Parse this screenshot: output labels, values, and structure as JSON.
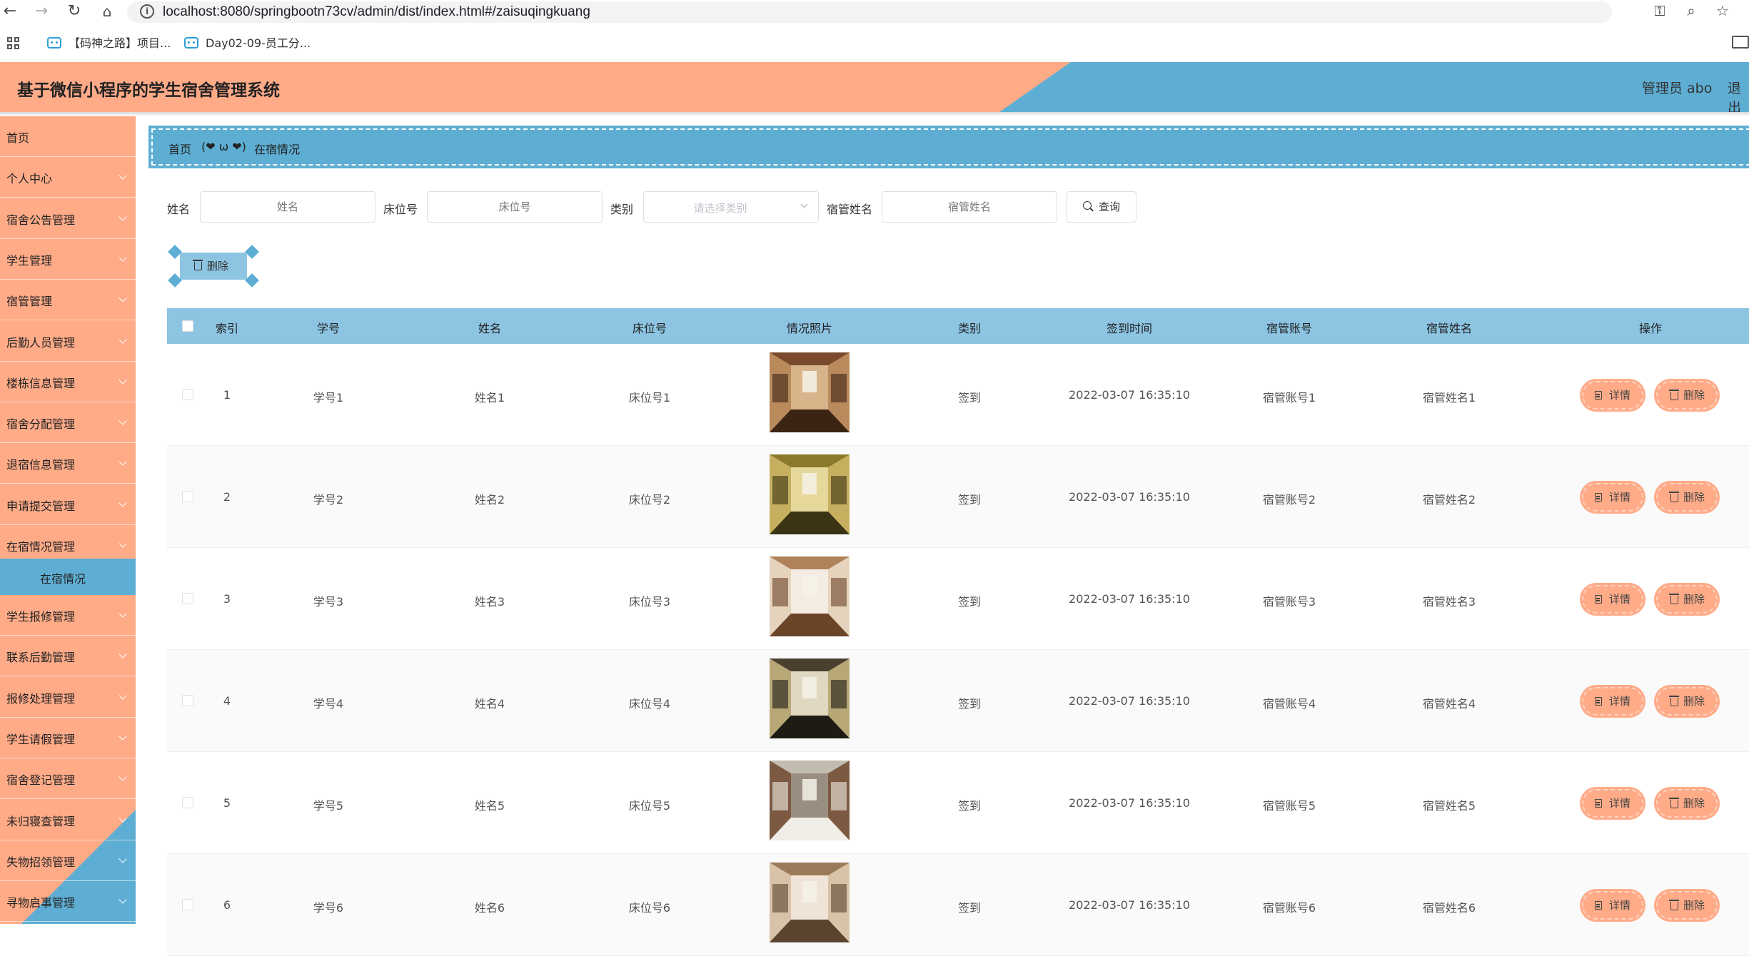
{
  "browser": {
    "url": "localhost:8080/springbootn73cv/admin/dist/index.html#/zaisuqingkuang",
    "bookmarks": [
      "【码神之路】项目...",
      "Day02-09-员工分..."
    ]
  },
  "header": {
    "title": "基于微信小程序的学生宿舍管理系统",
    "user": "管理员 abo",
    "logout": "退出"
  },
  "colors": {
    "primary": "#ffab88",
    "secondary": "#5eaed3",
    "table_header": "#8cc4e2"
  },
  "sidebar": {
    "items": [
      {
        "label": "首页",
        "chevron": false
      },
      {
        "label": "个人中心",
        "chevron": true
      },
      {
        "label": "宿舍公告管理",
        "chevron": true
      },
      {
        "label": "学生管理",
        "chevron": true
      },
      {
        "label": "宿管管理",
        "chevron": true
      },
      {
        "label": "后勤人员管理",
        "chevron": true
      },
      {
        "label": "楼栋信息管理",
        "chevron": true
      },
      {
        "label": "宿舍分配管理",
        "chevron": true
      },
      {
        "label": "退宿信息管理",
        "chevron": true
      },
      {
        "label": "申请提交管理",
        "chevron": true
      },
      {
        "label": "在宿情况管理",
        "chevron": true
      }
    ],
    "active_sub": "在宿情况",
    "items_after": [
      {
        "label": "学生报修管理"
      },
      {
        "label": "联系后勤管理"
      },
      {
        "label": "报修处理管理"
      },
      {
        "label": "学生请假管理"
      },
      {
        "label": "宿舍登记管理"
      },
      {
        "label": "未归寝查管理"
      },
      {
        "label": "失物招领管理"
      },
      {
        "label": "寻物启事管理"
      }
    ]
  },
  "breadcrumb": {
    "home": "首页",
    "separator": "(❤ ω ❤)",
    "current": "在宿情况"
  },
  "search": {
    "name_label": "姓名",
    "name_placeholder": "姓名",
    "bed_label": "床位号",
    "bed_placeholder": "床位号",
    "type_label": "类别",
    "type_placeholder": "请选择类别",
    "manager_label": "宿管姓名",
    "manager_placeholder": "宿管姓名",
    "query_button": "查询"
  },
  "batch_delete": "删除",
  "table": {
    "headers": [
      "索引",
      "学号",
      "姓名",
      "床位号",
      "情况照片",
      "类别",
      "签到时间",
      "宿管账号",
      "宿管姓名",
      "操作"
    ],
    "detail_label": "详情",
    "delete_label": "删除",
    "rows": [
      {
        "index": "1",
        "student_no": "学号1",
        "name": "姓名1",
        "bed": "床位号1",
        "type": "签到",
        "time": "2022-03-07 16:35:10",
        "account": "宿管账号1",
        "manager": "宿管姓名1"
      },
      {
        "index": "2",
        "student_no": "学号2",
        "name": "姓名2",
        "bed": "床位号2",
        "type": "签到",
        "time": "2022-03-07 16:35:10",
        "account": "宿管账号2",
        "manager": "宿管姓名2"
      },
      {
        "index": "3",
        "student_no": "学号3",
        "name": "姓名3",
        "bed": "床位号3",
        "type": "签到",
        "time": "2022-03-07 16:35:10",
        "account": "宿管账号3",
        "manager": "宿管姓名3"
      },
      {
        "index": "4",
        "student_no": "学号4",
        "name": "姓名4",
        "bed": "床位号4",
        "type": "签到",
        "time": "2022-03-07 16:35:10",
        "account": "宿管账号4",
        "manager": "宿管姓名4"
      },
      {
        "index": "5",
        "student_no": "学号5",
        "name": "姓名5",
        "bed": "床位号5",
        "type": "签到",
        "time": "2022-03-07 16:35:10",
        "account": "宿管账号5",
        "manager": "宿管姓名5"
      },
      {
        "index": "6",
        "student_no": "学号6",
        "name": "姓名6",
        "bed": "床位号6",
        "type": "签到",
        "time": "2022-03-07 16:35:10",
        "account": "宿管账号6",
        "manager": "宿管姓名6"
      }
    ]
  }
}
